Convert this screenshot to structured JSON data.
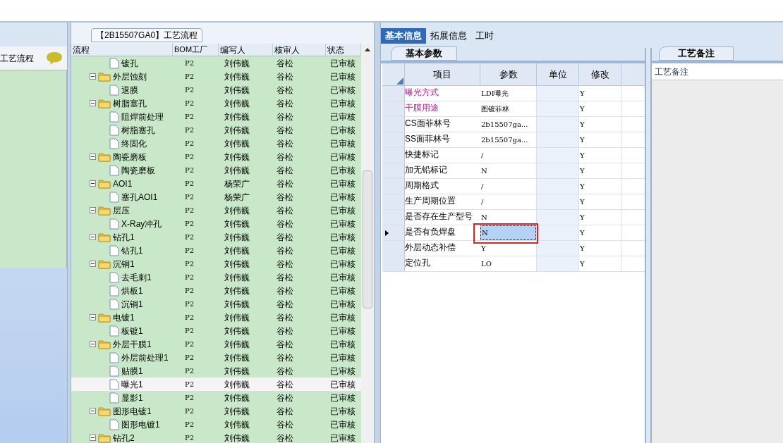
{
  "left_panel": {
    "title": "工艺流程"
  },
  "flow_panel": {
    "title": "【2B15507GA0】工艺流程",
    "columns": [
      "流程",
      "BOM工厂",
      "编写人",
      "核审人",
      "状态"
    ],
    "nodes": [
      {
        "children": [
          {
            "label": "镀孔",
            "bom": "P2",
            "writer": "刘伟巍",
            "reviewer": "谷松",
            "status": "已审核",
            "selected": false
          }
        ]
      },
      {
        "label": "外层蚀刻",
        "bom": "P2",
        "writer": "刘伟巍",
        "reviewer": "谷松",
        "status": "已审核",
        "selected": false,
        "children": [
          {
            "label": "退膜",
            "bom": "P2",
            "writer": "刘伟巍",
            "reviewer": "谷松",
            "status": "已审核",
            "selected": false
          }
        ]
      },
      {
        "label": "树脂塞孔",
        "bom": "P2",
        "writer": "刘伟巍",
        "reviewer": "谷松",
        "status": "已审核",
        "selected": false,
        "children": [
          {
            "label": "阻焊前处理",
            "bom": "P2",
            "writer": "刘伟巍",
            "reviewer": "谷松",
            "status": "已审核",
            "selected": false
          },
          {
            "label": "树脂塞孔",
            "bom": "P2",
            "writer": "刘伟巍",
            "reviewer": "谷松",
            "status": "已审核",
            "selected": false
          },
          {
            "label": "终固化",
            "bom": "P2",
            "writer": "刘伟巍",
            "reviewer": "谷松",
            "status": "已审核",
            "selected": false
          }
        ]
      },
      {
        "label": "陶瓷磨板",
        "bom": "P2",
        "writer": "刘伟巍",
        "reviewer": "谷松",
        "status": "已审核",
        "selected": false,
        "children": [
          {
            "label": "陶瓷磨板",
            "bom": "P2",
            "writer": "刘伟巍",
            "reviewer": "谷松",
            "status": "已审核",
            "selected": false
          }
        ]
      },
      {
        "label": "AOI1",
        "bom": "P2",
        "writer": "杨荣广",
        "reviewer": "谷松",
        "status": "已审核",
        "selected": false,
        "children": [
          {
            "label": "塞孔AOI1",
            "bom": "P2",
            "writer": "杨荣广",
            "reviewer": "谷松",
            "status": "已审核",
            "selected": false
          }
        ]
      },
      {
        "label": "层压",
        "bom": "P2",
        "writer": "刘伟巍",
        "reviewer": "谷松",
        "status": "已审核",
        "selected": false,
        "children": [
          {
            "label": "X-Ray冲孔",
            "bom": "P2",
            "writer": "刘伟巍",
            "reviewer": "谷松",
            "status": "已审核",
            "selected": false
          }
        ]
      },
      {
        "label": "钻孔1",
        "bom": "P2",
        "writer": "刘伟巍",
        "reviewer": "谷松",
        "status": "已审核",
        "selected": false,
        "children": [
          {
            "label": "钻孔1",
            "bom": "P2",
            "writer": "刘伟巍",
            "reviewer": "谷松",
            "status": "已审核",
            "selected": false
          }
        ]
      },
      {
        "label": "沉铜1",
        "bom": "P2",
        "writer": "刘伟巍",
        "reviewer": "谷松",
        "status": "已审核",
        "selected": false,
        "children": [
          {
            "label": "去毛刺1",
            "bom": "P2",
            "writer": "刘伟巍",
            "reviewer": "谷松",
            "status": "已审核",
            "selected": false
          },
          {
            "label": "烘板1",
            "bom": "P2",
            "writer": "刘伟巍",
            "reviewer": "谷松",
            "status": "已审核",
            "selected": false
          },
          {
            "label": "沉铜1",
            "bom": "P2",
            "writer": "刘伟巍",
            "reviewer": "谷松",
            "status": "已审核",
            "selected": false
          }
        ]
      },
      {
        "label": "电镀1",
        "bom": "P2",
        "writer": "刘伟巍",
        "reviewer": "谷松",
        "status": "已审核",
        "selected": false,
        "children": [
          {
            "label": "板镀1",
            "bom": "P2",
            "writer": "刘伟巍",
            "reviewer": "谷松",
            "status": "已审核",
            "selected": false
          }
        ]
      },
      {
        "label": "外层干膜1",
        "bom": "P2",
        "writer": "刘伟巍",
        "reviewer": "谷松",
        "status": "已审核",
        "selected": false,
        "children": [
          {
            "label": "外层前处理1",
            "bom": "P2",
            "writer": "刘伟巍",
            "reviewer": "谷松",
            "status": "已审核",
            "selected": false
          },
          {
            "label": "贴膜1",
            "bom": "P2",
            "writer": "刘伟巍",
            "reviewer": "谷松",
            "status": "已审核",
            "selected": false
          },
          {
            "label": "曝光1",
            "bom": "P2",
            "writer": "刘伟巍",
            "reviewer": "谷松",
            "status": "已审核",
            "selected": true
          },
          {
            "label": "显影1",
            "bom": "P2",
            "writer": "刘伟巍",
            "reviewer": "谷松",
            "status": "已审核",
            "selected": false
          }
        ]
      },
      {
        "label": "图形电镀1",
        "bom": "P2",
        "writer": "刘伟巍",
        "reviewer": "谷松",
        "status": "已审核",
        "selected": false,
        "children": [
          {
            "label": "图形电镀1",
            "bom": "P2",
            "writer": "刘伟巍",
            "reviewer": "谷松",
            "status": "已审核",
            "selected": false
          }
        ]
      },
      {
        "label": "钻孔2",
        "bom": "P2",
        "writer": "刘伟巍",
        "reviewer": "谷松",
        "status": "已审核",
        "selected": false
      }
    ]
  },
  "tabs": [
    {
      "label": "基本信息",
      "selected": true
    },
    {
      "label": "拓展信息",
      "selected": false
    },
    {
      "label": "工时",
      "selected": false
    }
  ],
  "params_panel": {
    "title": "基本参数",
    "columns": [
      "项目",
      "参数",
      "单位",
      "修改"
    ],
    "rows": [
      {
        "item": "曝光方式",
        "param": "LDI曝光",
        "modified": "Y",
        "highlighted": true,
        "selected": false
      },
      {
        "item": "干膜用途",
        "param": "图镀菲林",
        "modified": "Y",
        "highlighted": true,
        "selected": false
      },
      {
        "item": "CS面菲林号",
        "param": "2b15507ga...",
        "modified": "Y",
        "highlighted": false,
        "selected": false
      },
      {
        "item": "SS面菲林号",
        "param": "2b15507ga...",
        "modified": "Y",
        "highlighted": false,
        "selected": false
      },
      {
        "item": "快捷标记",
        "param": "/",
        "modified": "Y",
        "highlighted": false,
        "selected": false
      },
      {
        "item": "加无铅标记",
        "param": "N",
        "modified": "Y",
        "highlighted": false,
        "selected": false
      },
      {
        "item": "周期格式",
        "param": "/",
        "modified": "Y",
        "highlighted": false,
        "selected": false
      },
      {
        "item": "生产周期位置",
        "param": "/",
        "modified": "Y",
        "highlighted": false,
        "selected": false
      },
      {
        "item": "是否存在生产型号",
        "param": "N",
        "modified": "Y",
        "highlighted": false,
        "selected": false
      },
      {
        "item": "是否有负焊盘",
        "param": "N",
        "modified": "Y",
        "highlighted": false,
        "selected": true
      },
      {
        "item": "外层动态补偿",
        "param": "Y",
        "modified": "Y",
        "highlighted": false,
        "selected": false
      },
      {
        "item": "定位孔",
        "param": "LO",
        "modified": "Y",
        "highlighted": false,
        "selected": false
      }
    ]
  },
  "notes_panel": {
    "title": "工艺备注",
    "label": "工艺备注"
  }
}
